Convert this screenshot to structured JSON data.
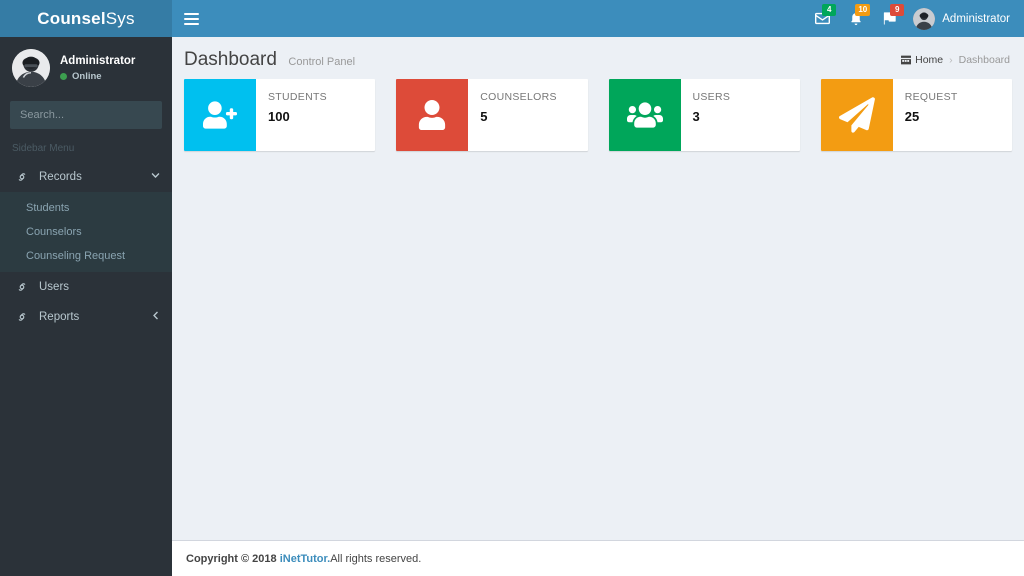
{
  "brand": {
    "bold_text": "Counsel",
    "light_text": "Sys"
  },
  "colors": {
    "navbar": "#3c8dbc",
    "logo": "#357ca5",
    "sidebar": "#2b3239",
    "submenu": "#2c3b41",
    "content_bg": "#ecf0f5",
    "aqua": "#00c0ef",
    "red": "#dd4b39",
    "green": "#00a65a",
    "yellow": "#f39c12",
    "link": "#3c8dbc"
  },
  "navbar": {
    "toggle_label": "Toggle navigation",
    "messages": {
      "icon": "envelope-icon",
      "count": "4",
      "color": "green"
    },
    "notifications": {
      "icon": "bell-icon",
      "count": "10",
      "color": "yellow"
    },
    "tasks": {
      "icon": "flag-icon",
      "count": "9",
      "color": "red"
    },
    "user": {
      "name": "Administrator",
      "avatar": "user-avatar"
    }
  },
  "sidebar": {
    "user_panel": {
      "name": "Administrator",
      "status": "Online"
    },
    "search": {
      "placeholder": "Search...",
      "value": "",
      "button_icon": "search-icon"
    },
    "menu_header": "Sidebar Menu",
    "items": [
      {
        "label": "Records",
        "icon": "link-icon",
        "chevron": "chevron-down-icon",
        "active": true,
        "children": [
          {
            "label": "Students"
          },
          {
            "label": "Counselors"
          },
          {
            "label": "Counseling Request"
          }
        ]
      },
      {
        "label": "Users",
        "icon": "link-icon",
        "chevron": "",
        "active": false,
        "children": []
      },
      {
        "label": "Reports",
        "icon": "link-icon",
        "chevron": "chevron-left-icon",
        "active": false,
        "children": []
      }
    ]
  },
  "content": {
    "title": "Dashboard",
    "subtitle": "Control Panel",
    "breadcrumb": {
      "home_icon": "dashboard-icon",
      "home": "Home",
      "separator": "›",
      "current": "Dashboard"
    },
    "info_boxes": [
      {
        "text": "STUDENTS",
        "number": "100",
        "icon": "user-plus-icon",
        "color": "#00c0ef"
      },
      {
        "text": "COUNSELORS",
        "number": "5",
        "icon": "user-icon",
        "color": "#dd4b39"
      },
      {
        "text": "USERS",
        "number": "3",
        "icon": "users-icon",
        "color": "#00a65a"
      },
      {
        "text": "REQUEST",
        "number": "25",
        "icon": "paper-plane-icon",
        "color": "#f39c12"
      }
    ]
  },
  "footer": {
    "copyright": "Copyright © 2018",
    "link": "iNetTutor.",
    "rights": " All rights reserved."
  }
}
